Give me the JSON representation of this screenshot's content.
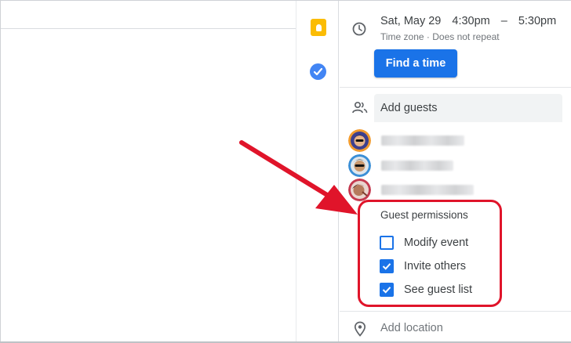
{
  "event": {
    "date": "Sat, May 29",
    "start_time": "4:30pm",
    "dash": "–",
    "end_time": "5:30pm",
    "subline": "Time zone · Does not repeat",
    "find_time_label": "Find a time"
  },
  "guests": {
    "placeholder": "Add guests",
    "items": [
      {
        "name_visible": false
      },
      {
        "name_visible": false
      },
      {
        "name_visible": false
      }
    ]
  },
  "permissions": {
    "title": "Guest permissions",
    "options": [
      {
        "label": "Modify event",
        "checked": false
      },
      {
        "label": "Invite others",
        "checked": true
      },
      {
        "label": "See guest list",
        "checked": true
      }
    ]
  },
  "location": {
    "placeholder": "Add location"
  },
  "colors": {
    "accent": "#1a73e8",
    "highlight": "#e0142a",
    "keep": "#fbbc04",
    "tasks": "#4285f4"
  },
  "icons": [
    "clock-icon",
    "people-icon",
    "location-pin-icon",
    "keep-icon",
    "tasks-icon",
    "checkbox-checked-icon",
    "arrow-annotation"
  ]
}
